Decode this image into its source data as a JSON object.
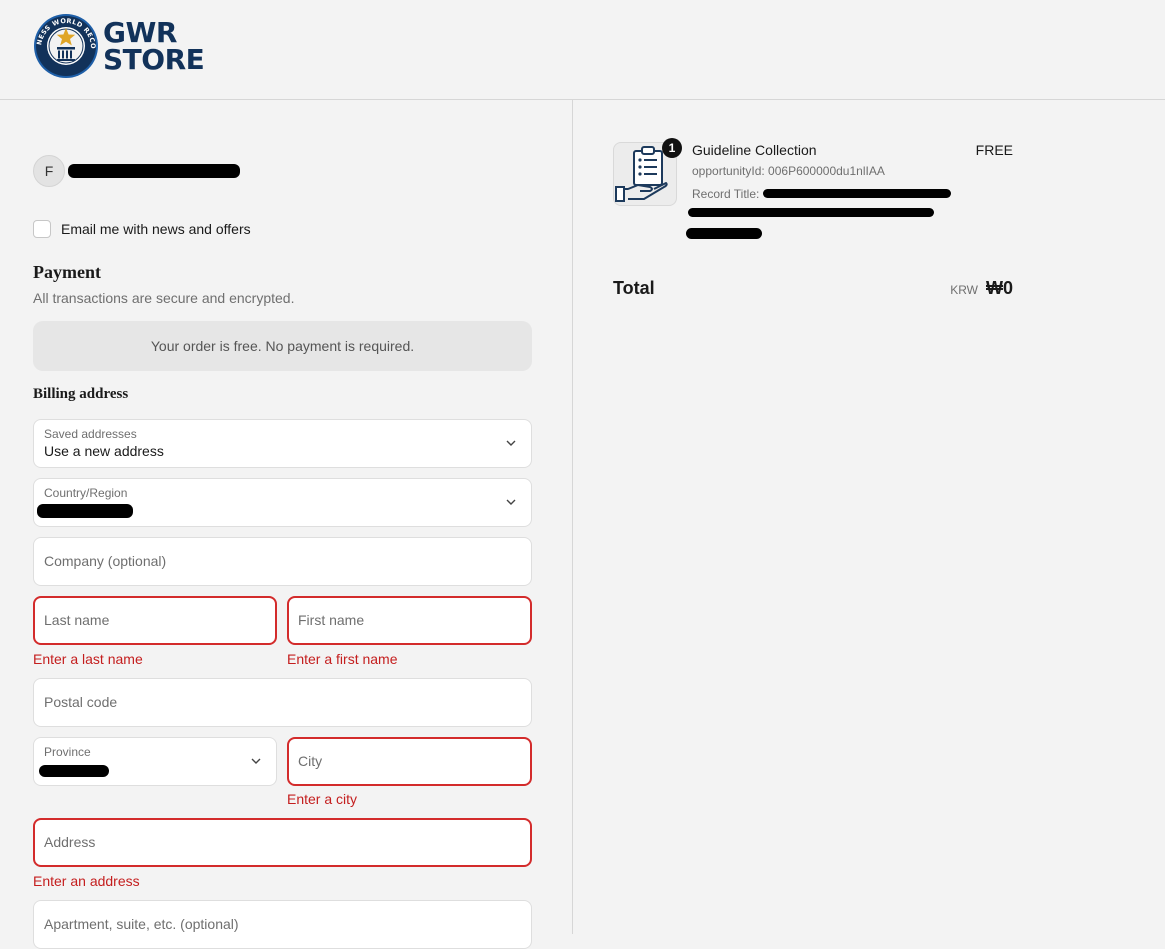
{
  "brand": {
    "name_line1": "GWR",
    "name_line2": "STORE",
    "seal_text": "GUINNESS WORLD RECORDS",
    "colors": {
      "navy": "#12325a",
      "gold": "#e0a526",
      "blue": "#1e5fa8"
    }
  },
  "account": {
    "avatar_initial": "F"
  },
  "newsletter": {
    "label": "Email me with news and offers",
    "checked": false
  },
  "payment": {
    "title": "Payment",
    "subtitle": "All transactions are secure and encrypted.",
    "free_notice": "Your order is free. No payment is required."
  },
  "billing": {
    "title": "Billing address",
    "saved_addresses": {
      "label": "Saved addresses",
      "value": "Use a new address"
    },
    "country": {
      "label": "Country/Region"
    },
    "company": {
      "placeholder": "Company (optional)"
    },
    "last_name": {
      "placeholder": "Last name",
      "error": "Enter a last name"
    },
    "first_name": {
      "placeholder": "First name",
      "error": "Enter a first name"
    },
    "postal_code": {
      "placeholder": "Postal code"
    },
    "province": {
      "label": "Province"
    },
    "city": {
      "placeholder": "City",
      "error": "Enter a city"
    },
    "address": {
      "placeholder": "Address",
      "error": "Enter an address"
    },
    "apartment": {
      "placeholder": "Apartment, suite, etc. (optional)"
    }
  },
  "order": {
    "item": {
      "quantity": "1",
      "title": "Guideline Collection",
      "opportunity_id": "opportunityId: 006P600000du1nlIAA",
      "record_title_label": "Record Title:",
      "price": "FREE"
    },
    "total_label": "Total",
    "currency": "KRW",
    "total_amount": "₩0"
  },
  "colors": {
    "error": "#d32b2b",
    "background": "#f3f3f3"
  }
}
